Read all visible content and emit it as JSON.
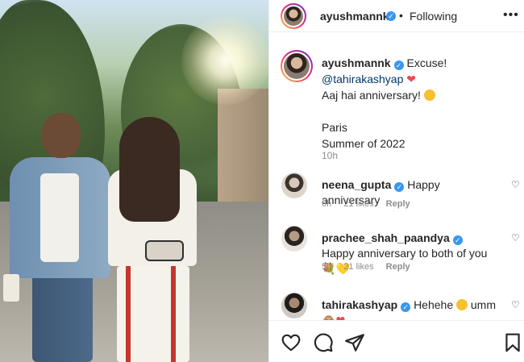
{
  "post": {
    "username": "ayushmannk",
    "follow_status": "Following",
    "separator": "•",
    "more": "•••",
    "caption": {
      "line1": "Excuse!",
      "mention": "@tahirakashyap",
      "heart": "❤",
      "line2": "Aaj hai anniversary!",
      "line3": "Paris",
      "line4": "Summer of 2022",
      "time": "10h"
    }
  },
  "comments": [
    {
      "username": "neena_gupta",
      "text": "Happy anniversary",
      "time": "6h",
      "likes": "21 likes",
      "reply": "Reply"
    },
    {
      "username": "prachee_shah_paandya",
      "text": "Happy anniversary to both of you",
      "emoji1": "💐",
      "emoji2": "💛",
      "time": "5h",
      "likes": "21 likes",
      "reply": "Reply"
    },
    {
      "username": "tahirakashyap",
      "text": "Hehehe",
      "text2": "umm",
      "emoji": "🙈",
      "heart": "❤"
    }
  ],
  "icons": {
    "verified": "✓",
    "like": "heart-outline-icon",
    "comment": "speech-bubble-icon",
    "share": "paper-plane-icon",
    "save": "bookmark-icon",
    "comment_like": "♡"
  },
  "colors": {
    "verified": "#3897f0",
    "secondary_text": "#8e8e8e",
    "mention": "#00376b"
  }
}
